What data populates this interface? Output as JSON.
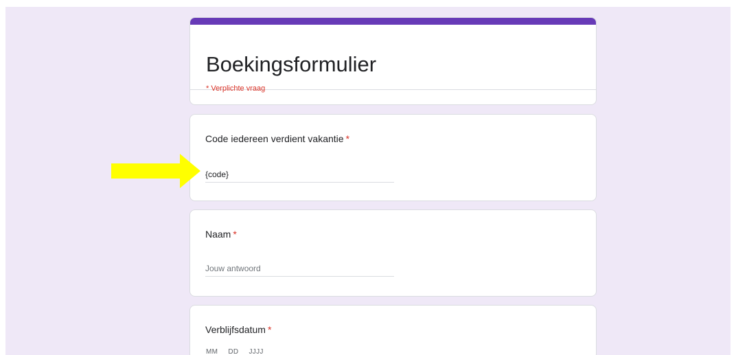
{
  "form": {
    "title": "Boekingsformulier",
    "required_note": "* Verplichte vraag",
    "accent_color": "#673ab7",
    "background_color": "#efe8f7",
    "required_color": "#d93025"
  },
  "questions": [
    {
      "title": "Code iedereen verdient vakantie",
      "required_mark": "*",
      "value": "{code}",
      "placeholder": ""
    },
    {
      "title": "Naam",
      "required_mark": "*",
      "value": "",
      "placeholder": "Jouw antwoord"
    },
    {
      "title": "Verblijfsdatum",
      "required_mark": "*",
      "date_labels": [
        "MM",
        "DD",
        "JJJJ"
      ]
    }
  ],
  "annotation": {
    "icon": "yellow-arrow-icon",
    "color": "#ffff00"
  }
}
